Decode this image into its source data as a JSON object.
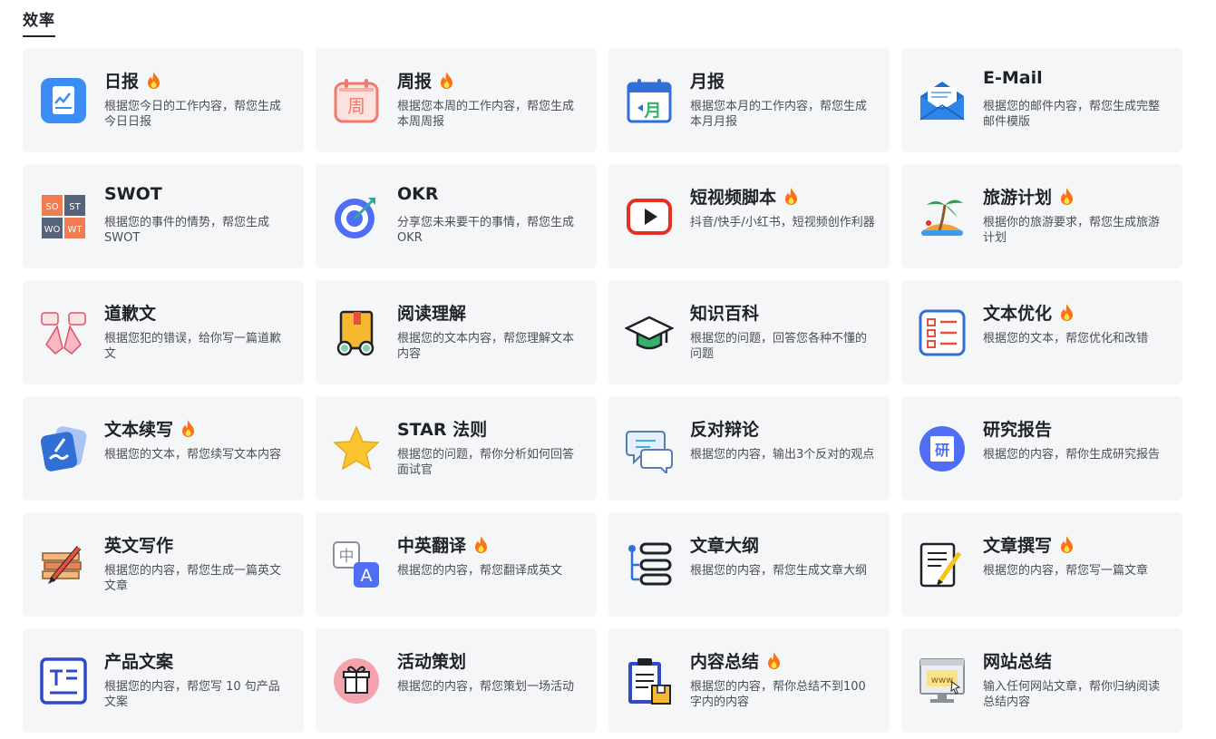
{
  "section": {
    "title": "效率"
  },
  "cards": [
    {
      "id": "daily",
      "title": "日报",
      "hot": true,
      "desc": "根据您今日的工作内容，帮您生成今日日报",
      "icon": "daily-report-icon"
    },
    {
      "id": "weekly",
      "title": "周报",
      "hot": true,
      "desc": "根据您本周的工作内容，帮您生成本周周报",
      "icon": "weekly-report-icon",
      "icon_text": "周"
    },
    {
      "id": "monthly",
      "title": "月报",
      "hot": false,
      "desc": "根据您本月的工作内容，帮您生成本月月报",
      "icon": "monthly-report-icon",
      "icon_text": "月"
    },
    {
      "id": "email",
      "title": "E-Mail",
      "hot": false,
      "desc": "根据您的邮件内容，帮您生成完整邮件模版",
      "icon": "email-envelope-icon"
    },
    {
      "id": "swot",
      "title": "SWOT",
      "hot": false,
      "desc": "根据您的事件的情势，帮您生成 SWOT",
      "icon": "swot-grid-icon",
      "icon_cells": [
        "SO",
        "ST",
        "WO",
        "WT"
      ]
    },
    {
      "id": "okr",
      "title": "OKR",
      "hot": false,
      "desc": "分享您未来要干的事情，帮您生成 OKR",
      "icon": "target-icon"
    },
    {
      "id": "video",
      "title": "短视频脚本",
      "hot": true,
      "desc": "抖音/快手/小红书，短视频创作利器",
      "icon": "video-play-icon"
    },
    {
      "id": "travel",
      "title": "旅游计划",
      "hot": true,
      "desc": "根据你的旅游要求，帮您生成旅游计划",
      "icon": "palm-island-icon"
    },
    {
      "id": "apology",
      "title": "道歉文",
      "hot": false,
      "desc": "根据您犯的错误，给你写一篇道歉文",
      "icon": "apology-hands-icon"
    },
    {
      "id": "reading",
      "title": "阅读理解",
      "hot": false,
      "desc": "根据您的文本内容，帮您理解文本内容",
      "icon": "book-glasses-icon"
    },
    {
      "id": "wiki",
      "title": "知识百科",
      "hot": false,
      "desc": "根据您的问题，回答您各种不懂的问题",
      "icon": "graduation-cap-icon"
    },
    {
      "id": "optimize",
      "title": "文本优化",
      "hot": true,
      "desc": "根据您的文本，帮您优化和改错",
      "icon": "text-list-icon"
    },
    {
      "id": "continue",
      "title": "文本续写",
      "hot": true,
      "desc": "根据您的文本，帮您续写文本内容",
      "icon": "continue-writing-icon"
    },
    {
      "id": "star",
      "title": "STAR 法则",
      "hot": false,
      "desc": "根据您的问题，帮你分析如何回答面试官",
      "icon": "star-icon"
    },
    {
      "id": "debate",
      "title": "反对辩论",
      "hot": false,
      "desc": "根据您的内容，输出3个反对的观点",
      "icon": "chat-bubbles-icon"
    },
    {
      "id": "research",
      "title": "研究报告",
      "hot": false,
      "desc": "根据您的内容，帮你生成研究报告",
      "icon": "research-book-icon",
      "icon_text": "研"
    },
    {
      "id": "english",
      "title": "英文写作",
      "hot": false,
      "desc": "根据您的内容，帮您生成一篇英文文章",
      "icon": "books-pencil-icon"
    },
    {
      "id": "translate",
      "title": "中英翻译",
      "hot": true,
      "desc": "根据您的内容，帮您翻译成英文",
      "icon": "translate-icon",
      "icon_text_zh": "中",
      "icon_text_en": "A"
    },
    {
      "id": "outline",
      "title": "文章大纲",
      "hot": false,
      "desc": "根据您的内容，帮您生成文章大纲",
      "icon": "outline-list-icon"
    },
    {
      "id": "article",
      "title": "文章撰写",
      "hot": true,
      "desc": "根据您的内容，帮您写一篇文章",
      "icon": "document-pencil-icon"
    },
    {
      "id": "product",
      "title": "产品文案",
      "hot": false,
      "desc": "根据您的内容，帮您写 10 句产品文案",
      "icon": "product-copy-icon"
    },
    {
      "id": "event",
      "title": "活动策划",
      "hot": false,
      "desc": "根据您的内容，帮您策划一场活动",
      "icon": "gift-icon"
    },
    {
      "id": "summary",
      "title": "内容总结",
      "hot": true,
      "desc": "根据您的内容，帮你总结不到100字内的内容",
      "icon": "clipboard-icon"
    },
    {
      "id": "website",
      "title": "网站总结",
      "hot": false,
      "desc": "输入任何网站文章，帮你归纳阅读总结内容",
      "icon": "website-monitor-icon",
      "icon_text": "www"
    }
  ],
  "colors": {
    "card_bg": "#f5f6f8",
    "title": "#1f2329",
    "desc": "#4a4f57",
    "fire": "#f97316"
  }
}
